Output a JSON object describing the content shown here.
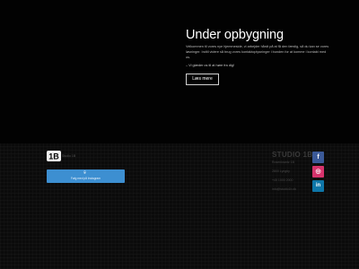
{
  "hero": {
    "title": "Under opbygning",
    "body": "Velkommen til vores nye hjemmeside, vi arbejder hårdt på at få den færdig, så du kan se vores løsninger. Indtil videre så brug vores kontaktoplysninger i bunden for at komme i kontakt med os.",
    "signoff": "– Vi glæder os til at høre fra dig!",
    "more_label": "Læs mere"
  },
  "footer": {
    "logo_text": "1B",
    "logo_caption": "Studio 1B",
    "instagram_label": "Følg med på Instagram",
    "studio_name": "STUDIO 1B",
    "address_line": "Rosenkrantz 1B",
    "city_line": "2800 Lyngby",
    "phone": "+45 1000 2000",
    "email": "info@studio1b.dk",
    "socials": [
      {
        "name": "facebook",
        "glyph": "f",
        "color": "#3b5998"
      },
      {
        "name": "instagram",
        "glyph": "◎",
        "color": "#d6336c"
      },
      {
        "name": "linkedin",
        "glyph": "in",
        "color": "#0e76a8"
      }
    ]
  }
}
